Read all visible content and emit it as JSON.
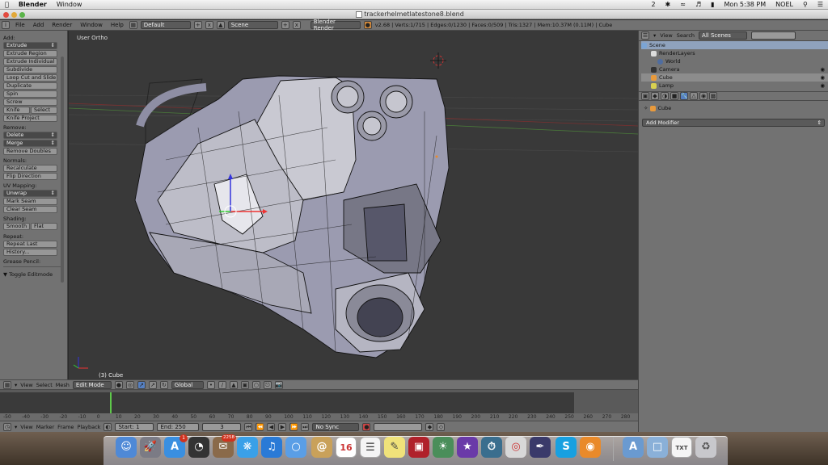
{
  "menubar": {
    "apple": "",
    "app_name": "Blender",
    "menu_window": "Window",
    "status": {
      "badge_num": "2",
      "clock": "Mon 5:38 PM",
      "user": "NOEL"
    }
  },
  "window": {
    "title": "trackerhelmetlatestone8.blend"
  },
  "header": {
    "menus": [
      "File",
      "Add",
      "Render",
      "Window",
      "Help"
    ],
    "layout": "Default",
    "scene": "Scene",
    "engine": "Blender Render",
    "stats": "v2.68 | Verts:1/715 | Edges:0/1230 | Faces:0/509 | Tris:1327 | Mem:10.37M (0.11M) | Cube"
  },
  "toolbar": {
    "add_label": "Add:",
    "add_buttons": [
      "Extrude",
      "Extrude Region",
      "Extrude Individual",
      "Subdivide",
      "Loop Cut and Slide",
      "Duplicate",
      "Spin",
      "Screw"
    ],
    "knife": "Knife",
    "select": "Select",
    "knife_project": "Knife Project",
    "remove_label": "Remove:",
    "delete": "Delete",
    "merge": "Merge",
    "remove_doubles": "Remove Doubles",
    "normals_label": "Normals:",
    "recalculate": "Recalculate",
    "flip_direction": "Flip Direction",
    "uv_label": "UV Mapping:",
    "unwrap": "Unwrap",
    "mark_seam": "Mark Seam",
    "clear_seam": "Clear Seam",
    "shading_label": "Shading:",
    "smooth": "Smooth",
    "flat": "Flat",
    "repeat_label": "Repeat:",
    "repeat_last": "Repeat Last",
    "history": "History...",
    "grease_label": "Grease Pencil:",
    "toggle_editmode": "Toggle Editmode"
  },
  "viewport": {
    "view_label": "User Ortho",
    "object_label": "(3) Cube"
  },
  "outliner": {
    "view": "View",
    "search": "Search",
    "filter": "All Scenes",
    "items": [
      "Scene",
      "RenderLayers",
      "World",
      "Camera",
      "Cube",
      "Lamp"
    ]
  },
  "properties": {
    "object": "Cube",
    "add_modifier": "Add Modifier"
  },
  "view3d_header": {
    "menus": [
      "View",
      "Select",
      "Mesh"
    ],
    "mode": "Edit Mode",
    "orientation": "Global"
  },
  "timeline": {
    "ruler": [
      "-50",
      "-40",
      "-30",
      "-20",
      "-10",
      "0",
      "10",
      "20",
      "30",
      "40",
      "50",
      "60",
      "70",
      "80",
      "90",
      "100",
      "110",
      "120",
      "130",
      "140",
      "150",
      "160",
      "170",
      "180",
      "190",
      "200",
      "210",
      "220",
      "230",
      "240",
      "250",
      "260",
      "270",
      "280"
    ],
    "menus": [
      "View",
      "Marker",
      "Frame",
      "Playback"
    ],
    "start": "Start: 1",
    "end": "End: 250",
    "current": "3",
    "sync": "No Sync"
  },
  "dock": {
    "ical_date": "16",
    "mail_badge": "2258",
    "appstore_badge": "1",
    "txt_label": "TXT"
  },
  "colors": {
    "blender_bg": "#727272",
    "viewport_bg": "#393939",
    "accent_blue": "#5680c2"
  }
}
